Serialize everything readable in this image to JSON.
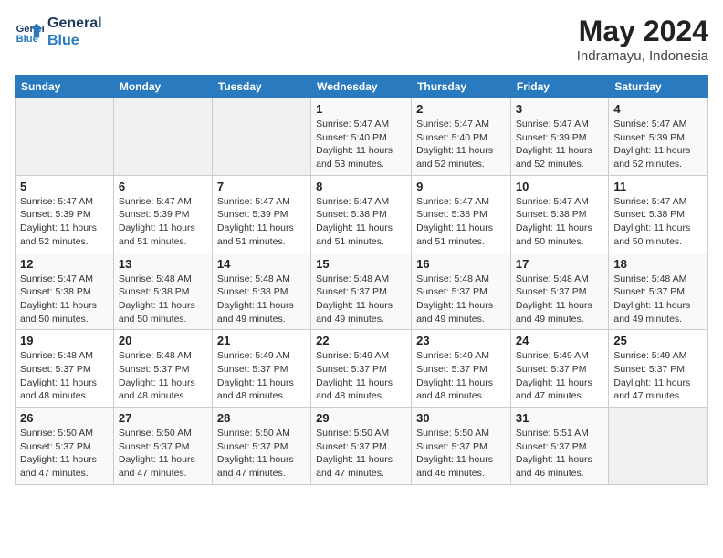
{
  "logo": {
    "line1": "General",
    "line2": "Blue"
  },
  "calendar": {
    "title": "May 2024",
    "subtitle": "Indramayu, Indonesia"
  },
  "weekdays": [
    "Sunday",
    "Monday",
    "Tuesday",
    "Wednesday",
    "Thursday",
    "Friday",
    "Saturday"
  ],
  "weeks": [
    [
      {
        "day": "",
        "info": ""
      },
      {
        "day": "",
        "info": ""
      },
      {
        "day": "",
        "info": ""
      },
      {
        "day": "1",
        "info": "Sunrise: 5:47 AM\nSunset: 5:40 PM\nDaylight: 11 hours\nand 53 minutes."
      },
      {
        "day": "2",
        "info": "Sunrise: 5:47 AM\nSunset: 5:40 PM\nDaylight: 11 hours\nand 52 minutes."
      },
      {
        "day": "3",
        "info": "Sunrise: 5:47 AM\nSunset: 5:39 PM\nDaylight: 11 hours\nand 52 minutes."
      },
      {
        "day": "4",
        "info": "Sunrise: 5:47 AM\nSunset: 5:39 PM\nDaylight: 11 hours\nand 52 minutes."
      }
    ],
    [
      {
        "day": "5",
        "info": "Sunrise: 5:47 AM\nSunset: 5:39 PM\nDaylight: 11 hours\nand 52 minutes."
      },
      {
        "day": "6",
        "info": "Sunrise: 5:47 AM\nSunset: 5:39 PM\nDaylight: 11 hours\nand 51 minutes."
      },
      {
        "day": "7",
        "info": "Sunrise: 5:47 AM\nSunset: 5:39 PM\nDaylight: 11 hours\nand 51 minutes."
      },
      {
        "day": "8",
        "info": "Sunrise: 5:47 AM\nSunset: 5:38 PM\nDaylight: 11 hours\nand 51 minutes."
      },
      {
        "day": "9",
        "info": "Sunrise: 5:47 AM\nSunset: 5:38 PM\nDaylight: 11 hours\nand 51 minutes."
      },
      {
        "day": "10",
        "info": "Sunrise: 5:47 AM\nSunset: 5:38 PM\nDaylight: 11 hours\nand 50 minutes."
      },
      {
        "day": "11",
        "info": "Sunrise: 5:47 AM\nSunset: 5:38 PM\nDaylight: 11 hours\nand 50 minutes."
      }
    ],
    [
      {
        "day": "12",
        "info": "Sunrise: 5:47 AM\nSunset: 5:38 PM\nDaylight: 11 hours\nand 50 minutes."
      },
      {
        "day": "13",
        "info": "Sunrise: 5:48 AM\nSunset: 5:38 PM\nDaylight: 11 hours\nand 50 minutes."
      },
      {
        "day": "14",
        "info": "Sunrise: 5:48 AM\nSunset: 5:38 PM\nDaylight: 11 hours\nand 49 minutes."
      },
      {
        "day": "15",
        "info": "Sunrise: 5:48 AM\nSunset: 5:37 PM\nDaylight: 11 hours\nand 49 minutes."
      },
      {
        "day": "16",
        "info": "Sunrise: 5:48 AM\nSunset: 5:37 PM\nDaylight: 11 hours\nand 49 minutes."
      },
      {
        "day": "17",
        "info": "Sunrise: 5:48 AM\nSunset: 5:37 PM\nDaylight: 11 hours\nand 49 minutes."
      },
      {
        "day": "18",
        "info": "Sunrise: 5:48 AM\nSunset: 5:37 PM\nDaylight: 11 hours\nand 49 minutes."
      }
    ],
    [
      {
        "day": "19",
        "info": "Sunrise: 5:48 AM\nSunset: 5:37 PM\nDaylight: 11 hours\nand 48 minutes."
      },
      {
        "day": "20",
        "info": "Sunrise: 5:48 AM\nSunset: 5:37 PM\nDaylight: 11 hours\nand 48 minutes."
      },
      {
        "day": "21",
        "info": "Sunrise: 5:49 AM\nSunset: 5:37 PM\nDaylight: 11 hours\nand 48 minutes."
      },
      {
        "day": "22",
        "info": "Sunrise: 5:49 AM\nSunset: 5:37 PM\nDaylight: 11 hours\nand 48 minutes."
      },
      {
        "day": "23",
        "info": "Sunrise: 5:49 AM\nSunset: 5:37 PM\nDaylight: 11 hours\nand 48 minutes."
      },
      {
        "day": "24",
        "info": "Sunrise: 5:49 AM\nSunset: 5:37 PM\nDaylight: 11 hours\nand 47 minutes."
      },
      {
        "day": "25",
        "info": "Sunrise: 5:49 AM\nSunset: 5:37 PM\nDaylight: 11 hours\nand 47 minutes."
      }
    ],
    [
      {
        "day": "26",
        "info": "Sunrise: 5:50 AM\nSunset: 5:37 PM\nDaylight: 11 hours\nand 47 minutes."
      },
      {
        "day": "27",
        "info": "Sunrise: 5:50 AM\nSunset: 5:37 PM\nDaylight: 11 hours\nand 47 minutes."
      },
      {
        "day": "28",
        "info": "Sunrise: 5:50 AM\nSunset: 5:37 PM\nDaylight: 11 hours\nand 47 minutes."
      },
      {
        "day": "29",
        "info": "Sunrise: 5:50 AM\nSunset: 5:37 PM\nDaylight: 11 hours\nand 47 minutes."
      },
      {
        "day": "30",
        "info": "Sunrise: 5:50 AM\nSunset: 5:37 PM\nDaylight: 11 hours\nand 46 minutes."
      },
      {
        "day": "31",
        "info": "Sunrise: 5:51 AM\nSunset: 5:37 PM\nDaylight: 11 hours\nand 46 minutes."
      },
      {
        "day": "",
        "info": ""
      }
    ]
  ]
}
